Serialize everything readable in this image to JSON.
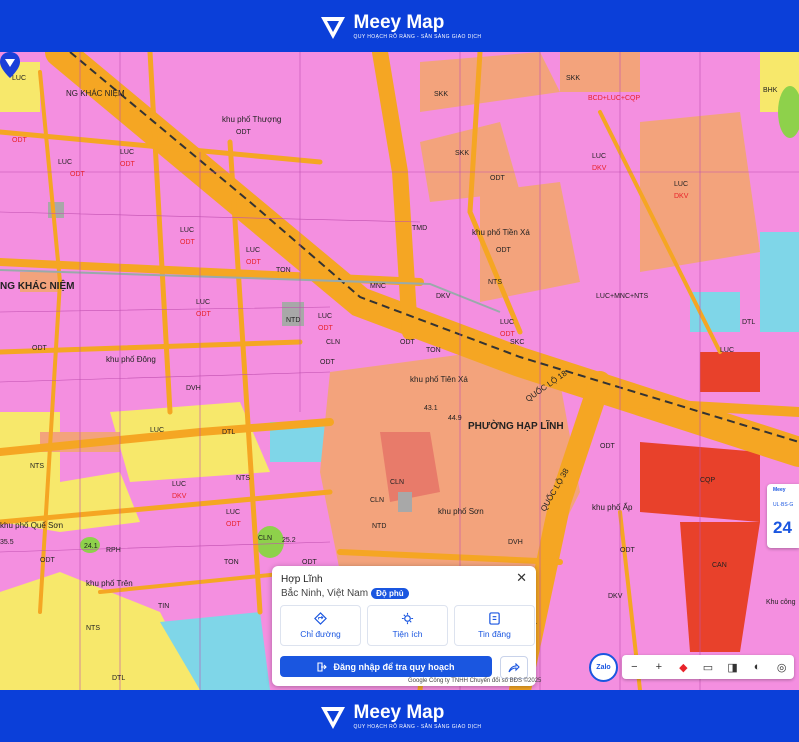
{
  "brand": {
    "name": "Meey Map",
    "tagline": "QUY HOẠCH RÕ RÀNG - SẴN SÀNG GIAO DỊCH"
  },
  "map": {
    "areas": [
      "khu phố Thượng",
      "khu phố Tiền Xá",
      "khu phố Đông",
      "khu phố Tiên Xá",
      "khu phố Sơn",
      "khu phố Ấp",
      "khu phố Quế Sơn",
      "khu phố Trên",
      "khu Trên",
      "khu phố",
      "NG KHÁC NIỆM",
      "PHƯỜNG HẠP LĨNH",
      "QUỐC LỘ 38",
      "QUỐC LỘ 18"
    ],
    "codes": [
      "LUC",
      "ODT",
      "DGD",
      "TIN",
      "SKK",
      "SKC",
      "NTD",
      "TON",
      "NTS",
      "DKV",
      "DVH",
      "CLN",
      "TMD",
      "DTL",
      "MNC",
      "CQP",
      "CAN",
      "RPH",
      "BHK",
      "BCD+LUC+CQP",
      "LUC+MNC+NTS"
    ],
    "elevations": [
      "43.1",
      "44.9",
      "24.1",
      "25.2",
      "35.5"
    ]
  },
  "popup": {
    "title": "Hợp Lĩnh",
    "subtitle": "Bắc Ninh, Việt Nam",
    "badge": "Độ phủ",
    "close": "✕",
    "actions": [
      {
        "label": "Chỉ đường",
        "icon": "directions-icon"
      },
      {
        "label": "Tiện ích",
        "icon": "utilities-icon"
      },
      {
        "label": "Tin đăng",
        "icon": "listing-icon"
      }
    ],
    "login": "Đăng nhập để tra quy hoạch"
  },
  "toolbar": {
    "zalo": "Zalo",
    "items": [
      "−",
      "+",
      "◆",
      "▭",
      "◨",
      "◐",
      "◎"
    ]
  },
  "attribution": "Google  Công ty TNHH Chuyển đổi số BĐS ©2025",
  "right_card": {
    "brand": "Meey",
    "line": "UL·BS·G",
    "value": "24"
  },
  "colors": {
    "residential": "#f48fe0",
    "road": "#f5a623",
    "agri": "#f7e86b",
    "commercial": "#f3a37c",
    "military": "#e8412b",
    "water": "#7fd6e8",
    "brand": "#0b3fd9"
  }
}
